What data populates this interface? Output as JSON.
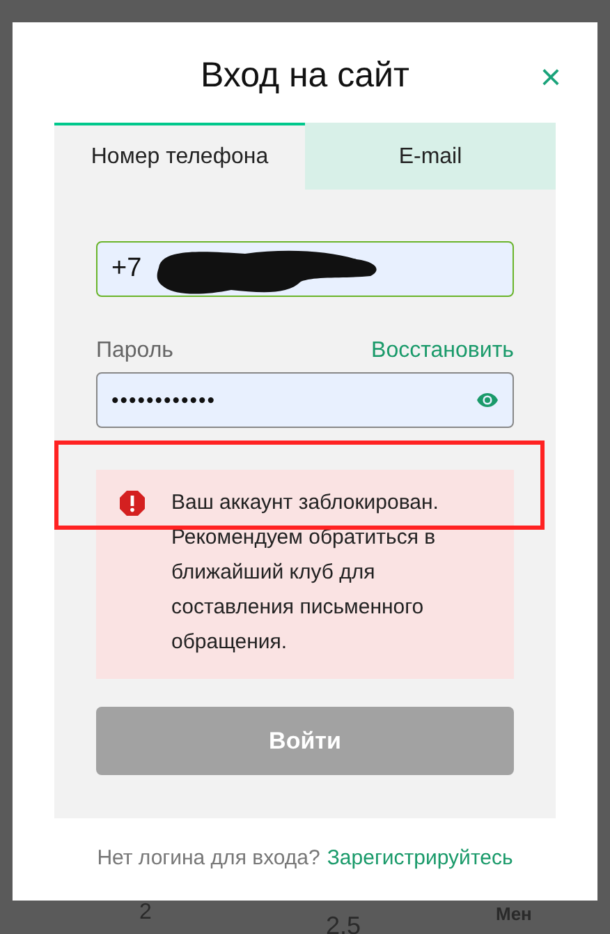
{
  "dialog": {
    "title": "Вход на сайт",
    "close": "×"
  },
  "tabs": [
    {
      "label": "Номер телефона",
      "selected": true
    },
    {
      "label": "E-mail",
      "selected": false
    }
  ],
  "phone": {
    "value": "+7"
  },
  "password": {
    "label": "Пароль",
    "recover_link": "Восстановить",
    "value": "••••••••••••"
  },
  "error": {
    "message": "Ваш аккаунт заблокирован. Рекомендуем обратиться в ближайший клуб для составления письменного обращения."
  },
  "submit": {
    "label": "Войти",
    "disabled": true
  },
  "footer": {
    "text": "Нет логина для входа?",
    "link": "Зарегистрируйтесь"
  },
  "background_cells": [
    "2",
    "2.5",
    "Мен"
  ]
}
